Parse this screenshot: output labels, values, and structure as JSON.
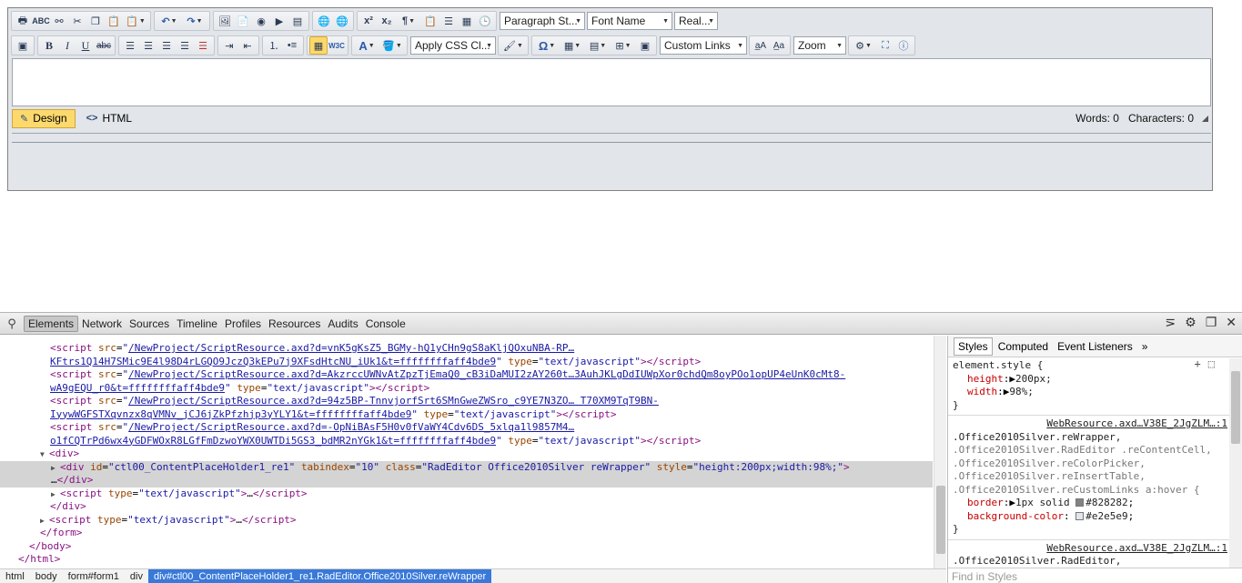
{
  "editor": {
    "toolbar1": {
      "paragraph_style": "Paragraph St...",
      "font_name": "Font Name",
      "real_font_size": "Real..."
    },
    "toolbar2": {
      "apply_css_class": "Apply CSS Cl...",
      "custom_links": "Custom Links",
      "zoom": "Zoom"
    },
    "modes": {
      "design": "Design",
      "html": "HTML"
    },
    "stats": {
      "words": "Words: 0",
      "characters": "Characters: 0"
    }
  },
  "devtools": {
    "tabs": [
      "Elements",
      "Network",
      "Sources",
      "Timeline",
      "Profiles",
      "Resources",
      "Audits",
      "Console"
    ],
    "dom": {
      "l1_src": "/NewProject/ScriptResource.axd?d=vnK5gKsZ5_BGMy-hQ1yCHn9gS8aKljQOxuNBA-RP…",
      "l2_src": "KFtrs1Q14H7SMic9E4l98D4rLGQO9JczQ3kEPu7j9XFsdHtcNU_iUk1&t=ffffffffaff4bde9",
      "l3_src": "/NewProject/ScriptResource.axd?d=AkzrccUWNvAtZpzTjEmaQ0_cB3iDaMUI2zAY260t…3AuhJKLgDdIUWpXor0chdQm8oyPOo1opUP4eUnK0cMt8-",
      "l4_src": "wA9gEQU_r0&t=ffffffffaff4bde9",
      "l5_src": "/NewProject/ScriptResource.axd?d=94z5BP-TnnvjorfSrt6SMnGweZWSro_c9YE7N3ZO… T70XM9TqT9BN-",
      "l6_src": "IyywWGFSTXqvnzx8qVMNv_jCJ6jZkPfzhjp3yYLY1&t=ffffffffaff4bde9",
      "l7_src": "/NewProject/ScriptResource.axd?d=-OpNiBAsF5H0v0fVaWY4Cdv6DS_5xlqa1l9857M4…",
      "l8_src": "o1fCQTrPd6wx4yGDFWOxR8LGfFmDzwoYWX0UWTDi5GS3_bdMR2nYGk1&t=ffffffffaff4bde9",
      "type_js": "\"text/javascript\"",
      "div_id": "\"ctl00_ContentPlaceHolder1_re1\"",
      "div_tabindex": "\"10\"",
      "div_class": "\"RadEditor Office2010Silver reWrapper\"",
      "div_style": "\"height:200px;width:98%;\""
    },
    "breadcrumbs": [
      "html",
      "body",
      "form#form1",
      "div",
      "div#ctl00_ContentPlaceHolder1_re1.RadEditor.Office2010Silver.reWrapper"
    ],
    "styles_tabs": [
      "Styles",
      "Computed",
      "Event Listeners"
    ],
    "styles": {
      "element_style": "element.style {",
      "height_name": "height",
      "height_val": "200px;",
      "width_name": "width",
      "width_val": "98%;",
      "rule1_src": "WebResource.axd…V38E_2JgZLM…:1",
      "rule1_sel1": ".Office2010Silver.reWrapper,",
      "rule1_sel2": ".Office2010Silver.RadEditor .reContentCell,",
      "rule1_sel3": ".Office2010Silver.reColorPicker,",
      "rule1_sel4": ".Office2010Silver.reInsertTable,",
      "rule1_sel5": ".Office2010Silver.reCustomLinks a:hover {",
      "border_name": "border",
      "border_val": "1px solid",
      "border_color": "#828282",
      "bg_name": "background-color",
      "bg_color": "#e2e5e9",
      "rule2_src": "WebResource.axd…V38E_2JgZLM…:1",
      "rule2_sel1": ".Office2010Silver.RadEditor,",
      "find_placeholder": "Find in Styles"
    }
  }
}
